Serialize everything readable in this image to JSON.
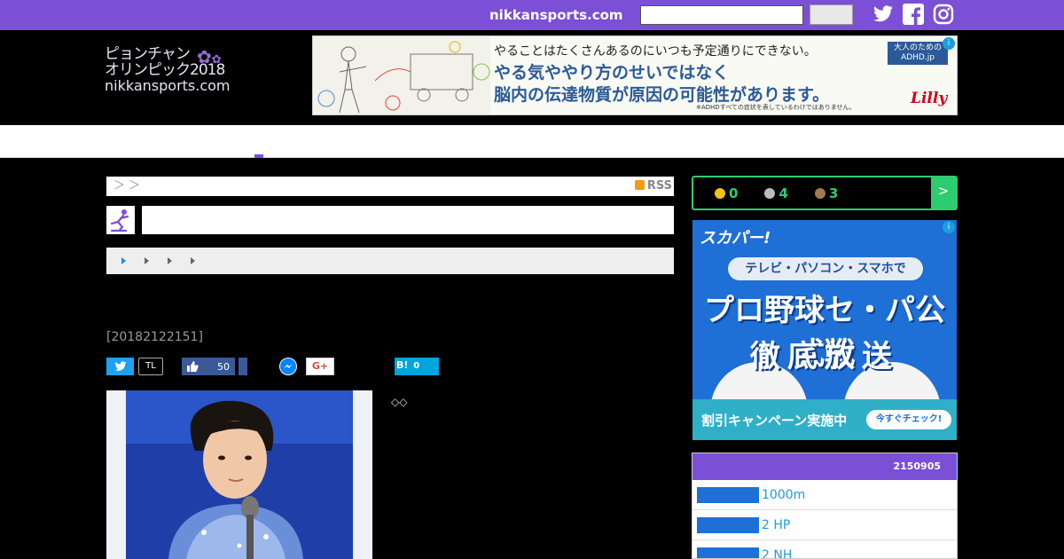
{
  "topbar": {
    "brand": "nikkansports.com",
    "search_placeholder": "",
    "search_button_label": ""
  },
  "header": {
    "logo_line1": "ピョンチャン",
    "logo_line2": "オリンピック2018",
    "logo_line3": "nikkansports.com"
  },
  "ad_top": {
    "line1": "やることはたくさんあるのにいつも予定通りにできない。",
    "line2": "やる気ややり方のせいではなく",
    "line3": "脳内の伝達物質が原因の可能性があります。",
    "note": "※ADHDすべての症状を表しているわけではありません。",
    "badge": "大人のための ADHD.jp",
    "brand": "Lilly",
    "info": "i"
  },
  "breadcrumb": {
    "text": "＞ ＞",
    "rss_label": "RSS"
  },
  "article": {
    "date": "[20182122151]",
    "diamonds": "◇◇"
  },
  "share": {
    "timeline_label": "TL",
    "facebook_count": "50",
    "googleplus_label": "G+",
    "hatena_label": "B!",
    "hatena_count": "0"
  },
  "medals": {
    "gold": "0",
    "silver": "4",
    "bronze": "3",
    "more": ">",
    "gold_color": "#f1c40f",
    "silver_color": "#bdbdbd",
    "bronze_color": "#a5784f"
  },
  "ad_side": {
    "brand": "スカパー!",
    "tagline": "テレビ・パソコン・スマホで",
    "headline1": "プロ野球セ・パ公式戦",
    "headline2": "徹底放送",
    "campaign": "割引キャンペーン実施中",
    "cta": "今すぐチェック!",
    "info": "i"
  },
  "ranking": {
    "header": "2150905",
    "items": [
      {
        "label": "1000m"
      },
      {
        "label": "2 HP"
      },
      {
        "label": "2 NH"
      }
    ]
  },
  "colors": {
    "accent": "#7b4fd6",
    "medal_green": "#2ecc71"
  }
}
